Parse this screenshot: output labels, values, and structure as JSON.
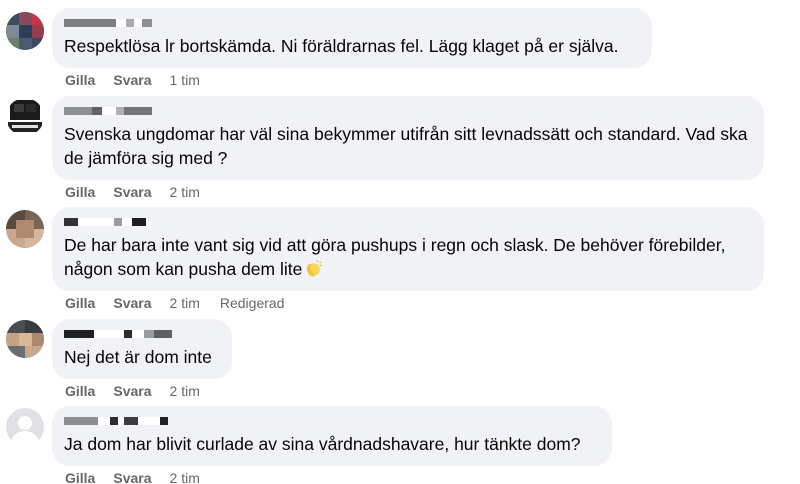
{
  "comments": [
    {
      "author_redacted": true,
      "text": "Respektlösa lr bortskämda. Ni föräldrarnas fel. Lägg klaget på er själva.",
      "actions": {
        "like": "Gilla",
        "reply": "Svara",
        "time": "1 tim",
        "edited": ""
      }
    },
    {
      "author_redacted": true,
      "text": "Svenska ungdomar har väl sina bekymmer utifrån sitt levnadssätt och standard. Vad ska de jämföra sig med ?",
      "actions": {
        "like": "Gilla",
        "reply": "Svara",
        "time": "2 tim",
        "edited": ""
      }
    },
    {
      "author_redacted": true,
      "text": "De har bara inte vant sig vid att göra pushups i regn och slask. De behöver förebilder, någon som kan pusha dem lite",
      "emoji": "clapping-hands-icon",
      "actions": {
        "like": "Gilla",
        "reply": "Svara",
        "time": "2 tim",
        "edited": "Redigerad"
      }
    },
    {
      "author_redacted": true,
      "text": "Nej det är dom inte",
      "actions": {
        "like": "Gilla",
        "reply": "Svara",
        "time": "2 tim",
        "edited": ""
      }
    },
    {
      "author_redacted": true,
      "text": "Ja dom har blivit curlade av sina vårdnadshavare, hur tänkte dom?",
      "actions": {
        "like": "Gilla",
        "reply": "Svara",
        "time": "2 tim",
        "edited": ""
      }
    }
  ],
  "colors": {
    "bubble": "#f0f2f5",
    "text": "#050505",
    "meta": "#65676b"
  }
}
